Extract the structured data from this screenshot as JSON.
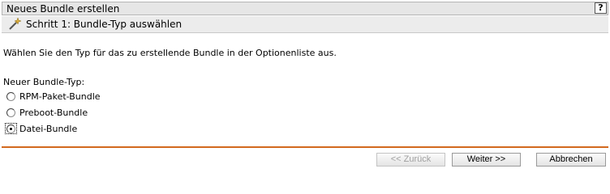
{
  "window": {
    "title": "Neues Bundle erstellen",
    "help_label": "?"
  },
  "step": {
    "title": "Schritt 1: Bundle-Typ auswählen",
    "icon": "wand-icon"
  },
  "instruction": "Wählen Sie den Typ für das zu erstellende Bundle in der Optionenliste aus.",
  "bundle_type": {
    "label": "Neuer Bundle-Typ:",
    "options": [
      {
        "label": "RPM-Paket-Bundle",
        "selected": false
      },
      {
        "label": "Preboot-Bundle",
        "selected": false
      },
      {
        "label": "Datei-Bundle",
        "selected": true
      }
    ]
  },
  "buttons": {
    "back": "<< Zurück",
    "next": "Weiter >>",
    "cancel": "Abbrechen"
  },
  "colors": {
    "divider": "#d2691e",
    "header_bg": "#e6e6e6"
  }
}
